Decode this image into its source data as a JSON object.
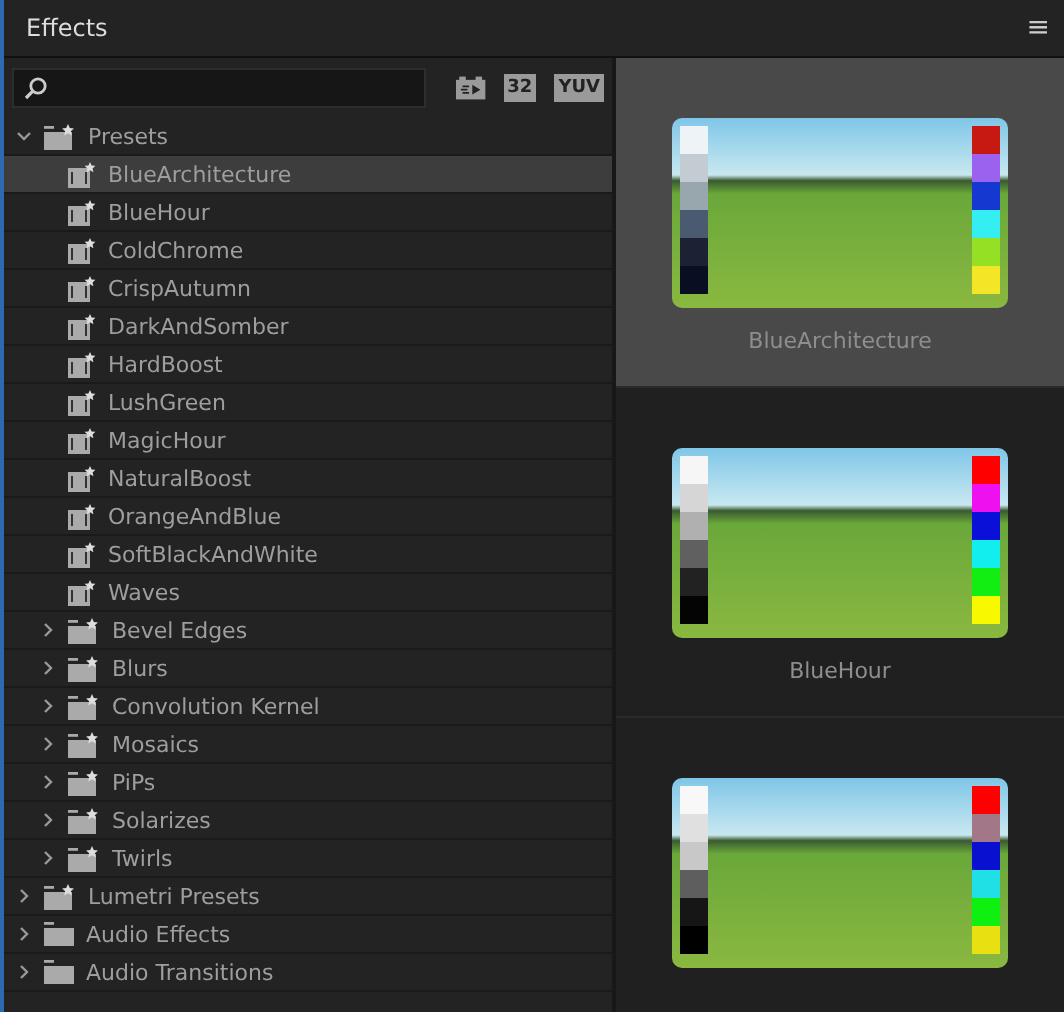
{
  "panel": {
    "title": "Effects",
    "menu_icon": "≡"
  },
  "toolbar": [
    "32",
    "YUV"
  ],
  "tree": [
    {
      "label": "Presets",
      "kind": "fx-folder",
      "expanded": true,
      "selected": false,
      "children": [
        {
          "label": "BlueArchitecture",
          "kind": "preset",
          "selected": true
        },
        {
          "label": "BlueHour",
          "kind": "preset",
          "selected": false
        },
        {
          "label": "ColdChrome",
          "kind": "preset",
          "selected": false
        },
        {
          "label": "CrispAutumn",
          "kind": "preset",
          "selected": false
        },
        {
          "label": "DarkAndSomber",
          "kind": "preset",
          "selected": false
        },
        {
          "label": "HardBoost",
          "kind": "preset",
          "selected": false
        },
        {
          "label": "LushGreen",
          "kind": "preset",
          "selected": false
        },
        {
          "label": "MagicHour",
          "kind": "preset",
          "selected": false
        },
        {
          "label": "NaturalBoost",
          "kind": "preset",
          "selected": false
        },
        {
          "label": "OrangeAndBlue",
          "kind": "preset",
          "selected": false
        },
        {
          "label": "SoftBlackAndWhite",
          "kind": "preset",
          "selected": false
        },
        {
          "label": "Waves",
          "kind": "preset",
          "selected": false
        },
        {
          "label": "Bevel Edges",
          "kind": "fx-folder",
          "expanded": false,
          "selected": false
        },
        {
          "label": "Blurs",
          "kind": "fx-folder",
          "expanded": false,
          "selected": false
        },
        {
          "label": "Convolution Kernel",
          "kind": "fx-folder",
          "expanded": false,
          "selected": false
        },
        {
          "label": "Mosaics",
          "kind": "fx-folder",
          "expanded": false,
          "selected": false
        },
        {
          "label": "PiPs",
          "kind": "fx-folder",
          "expanded": false,
          "selected": false
        },
        {
          "label": "Solarizes",
          "kind": "fx-folder",
          "expanded": false,
          "selected": false
        },
        {
          "label": "Twirls",
          "kind": "fx-folder",
          "expanded": false,
          "selected": false
        }
      ]
    },
    {
      "label": "Lumetri Presets",
      "kind": "fx-folder",
      "expanded": false,
      "selected": false
    },
    {
      "label": "Audio Effects",
      "kind": "folder",
      "expanded": false,
      "selected": false
    },
    {
      "label": "Audio Transitions",
      "kind": "folder",
      "expanded": false,
      "selected": false
    }
  ],
  "previews": [
    {
      "label": "BlueArchitecture",
      "selected": true,
      "left_swatches": [
        {
          "color": "#eef3f8"
        },
        {
          "color": "#c2ccd2"
        },
        {
          "color": "#98a6ae"
        },
        {
          "color": "#4a5a70"
        },
        {
          "color": "#1c2234"
        },
        {
          "color": "#0a0e22"
        }
      ],
      "right_swatches": [
        {
          "color": "#c81812"
        },
        {
          "color": "#9a62ee"
        },
        {
          "color": "#1438d0"
        },
        {
          "color": "#34eef2"
        },
        {
          "color": "#94e024"
        },
        {
          "color": "#f2e626"
        }
      ]
    },
    {
      "label": "BlueHour",
      "selected": false,
      "left_swatches": [
        {
          "color": "#f6f6f6"
        },
        {
          "color": "#d6d6d6"
        },
        {
          "color": "#b0b0b0"
        },
        {
          "color": "#606060"
        },
        {
          "color": "#222222"
        },
        {
          "color": "#040404"
        }
      ],
      "right_swatches": [
        {
          "color": "#fe0000"
        },
        {
          "color": "#ee10ee"
        },
        {
          "color": "#0a10d8"
        },
        {
          "color": "#12eeee"
        },
        {
          "color": "#12ee12"
        },
        {
          "color": "#f8f800"
        }
      ]
    },
    {
      "selected": false,
      "left_swatches": [
        {
          "color": "#f8f8f8"
        },
        {
          "color": "#e0e0e0"
        },
        {
          "color": "#c8c8c8"
        },
        {
          "color": "#5e5e5e"
        },
        {
          "color": "#161616"
        },
        {
          "color": "#000000"
        }
      ],
      "right_swatches": [
        {
          "color": "#fe0000"
        },
        {
          "color": "#a27888"
        },
        {
          "color": "#0a10d0"
        },
        {
          "color": "#20e0e6"
        },
        {
          "color": "#10f010"
        },
        {
          "color": "#e8e010"
        }
      ]
    }
  ]
}
